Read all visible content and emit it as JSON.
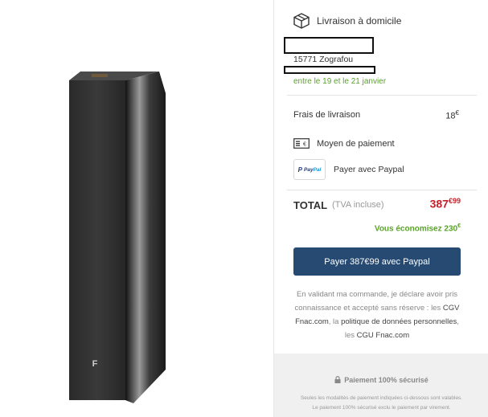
{
  "product": {
    "brand_mark": "F"
  },
  "delivery": {
    "title": "Livraison à domicile",
    "postal": "15771 Zografou",
    "dates": "entre le 19 et le 21 janvier"
  },
  "fees": {
    "label": "Frais de livraison",
    "value": "18",
    "currency": "€"
  },
  "payment": {
    "title": "Moyen de paiement",
    "method_label": "Payer avec Paypal",
    "logo_text_bold": "Pay",
    "logo_text_light": "Pal"
  },
  "total": {
    "label": "TOTAL",
    "sub": "(TVA incluse)",
    "price_main": "387",
    "price_cents": "€99"
  },
  "savings": {
    "text": "Vous économisez 230",
    "currency": "€"
  },
  "pay_button": {
    "label": "Payer 387€99 avec Paypal"
  },
  "legal": {
    "line1": "En validant ma commande, je déclare avoir pris connaissance et accepté sans réserve :",
    "cgv_prefix": "les ",
    "cgv_link": "CGV Fnac.com",
    "mid": ", la ",
    "policy_link": "politique de données personnelles",
    "mid2": ", les ",
    "cgu_link": "CGU Fnac.com"
  },
  "secure": {
    "title": "Paiement 100% sécurisé",
    "note1": "Seules les modalités de paiement indiquées ci-dessous sont valables.",
    "note2": "Le paiement 100% sécurisé exclu le paiement par virement."
  },
  "colors": {
    "accent_green": "#5aa22a",
    "price_red": "#c41f2a",
    "button_blue": "#264a72"
  },
  "icons": [
    "box-icon",
    "card-icon",
    "paypal-logo",
    "lock-icon"
  ]
}
